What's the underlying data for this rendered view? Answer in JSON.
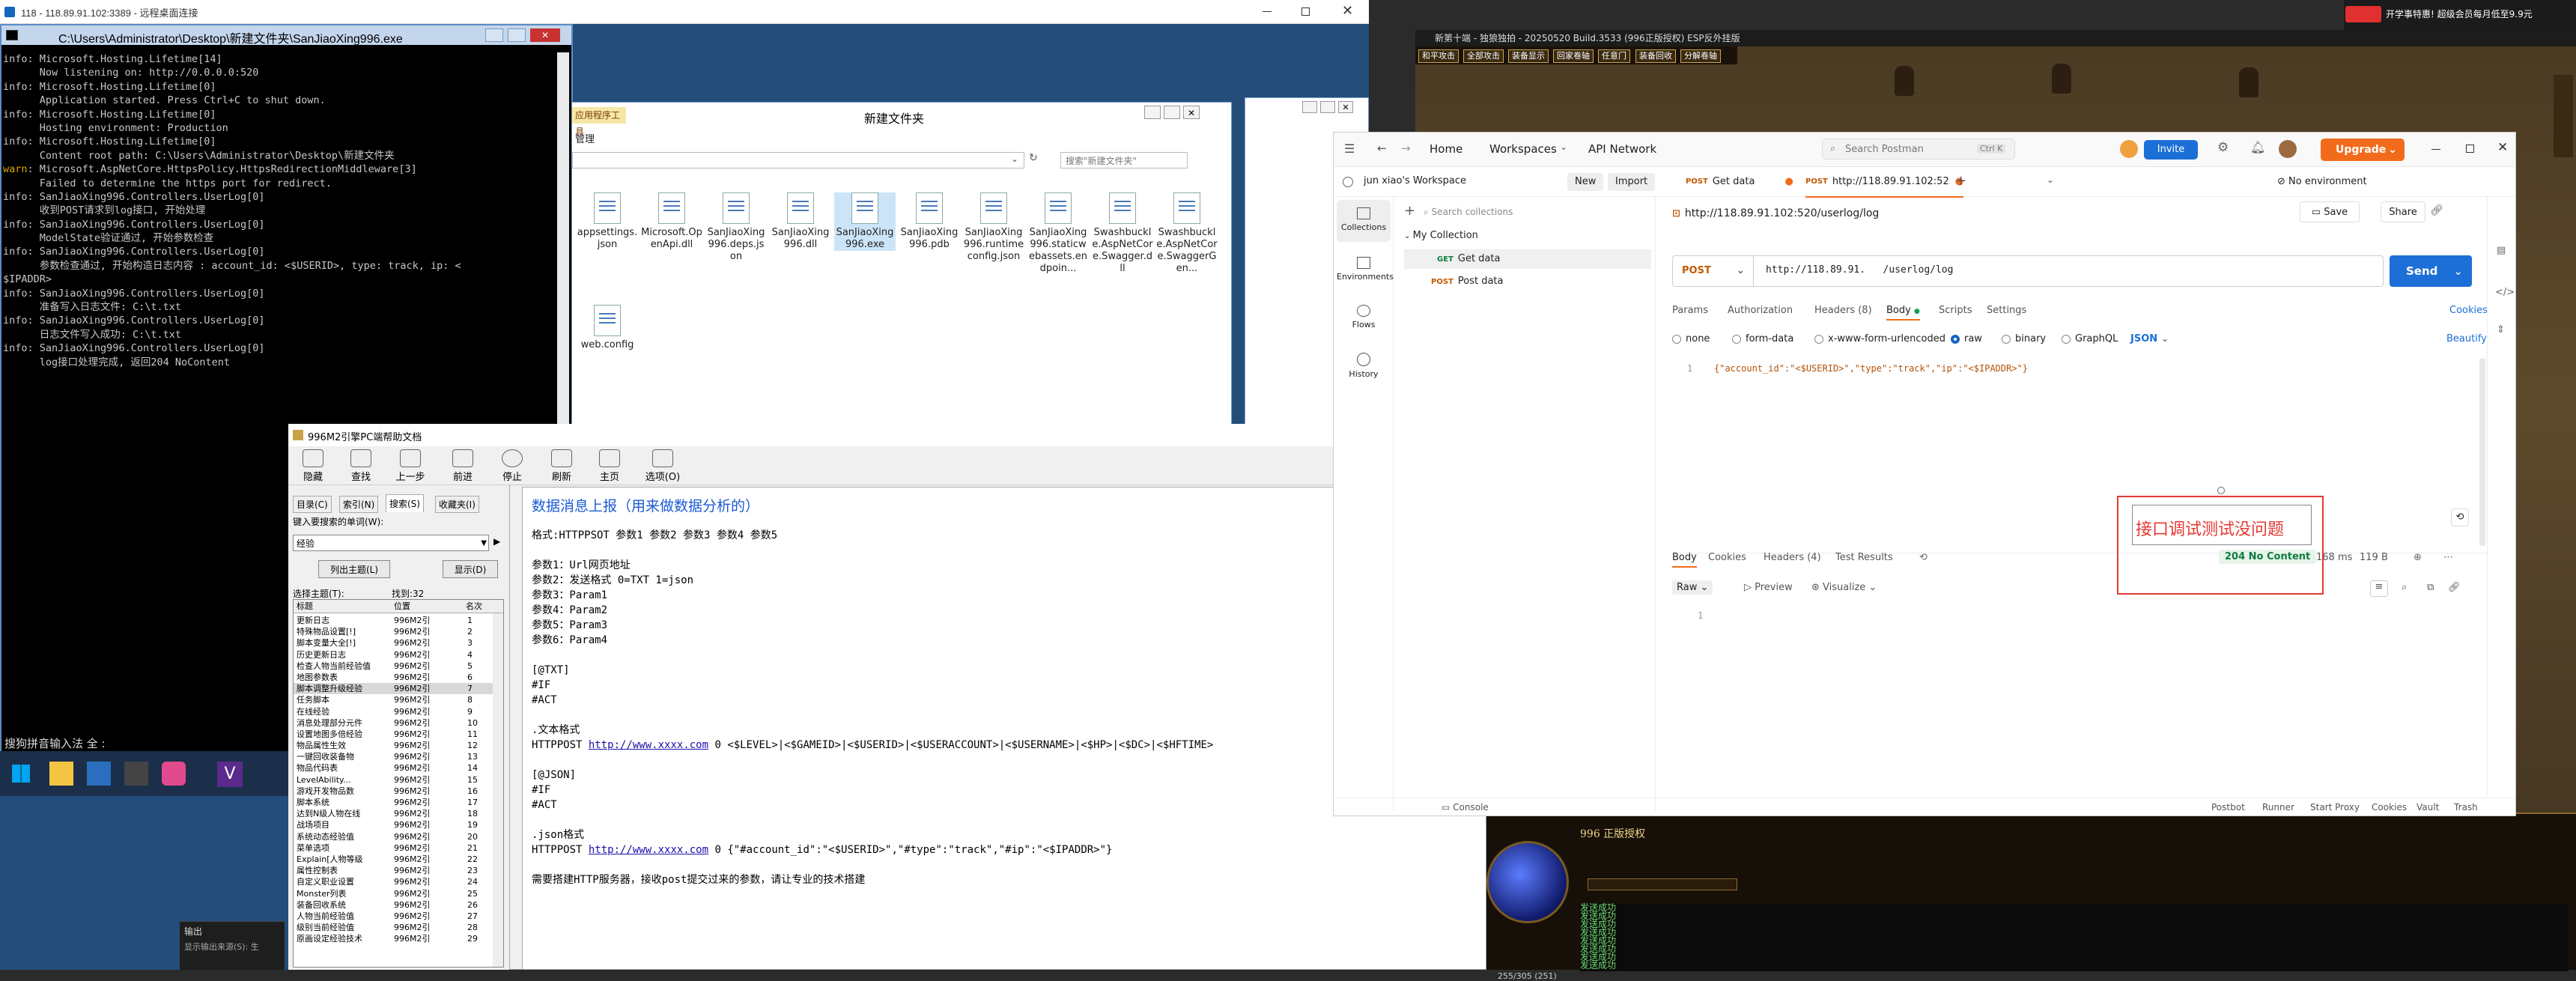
{
  "remote": {
    "title": "118 - 118.89.91.102:3389 - 远程桌面连接"
  },
  "cmd": {
    "title": "C:\\Users\\Administrator\\Desktop\\新建文件夹\\SanJiaoXing996.exe",
    "lines": [
      {
        "lvl": "info",
        "text": "Microsoft.Hosting.Lifetime[14]"
      },
      {
        "lvl": "",
        "text": "      Now listening on: http://0.0.0.0:520"
      },
      {
        "lvl": "info",
        "text": "Microsoft.Hosting.Lifetime[0]"
      },
      {
        "lvl": "",
        "text": "      Application started. Press Ctrl+C to shut down."
      },
      {
        "lvl": "info",
        "text": "Microsoft.Hosting.Lifetime[0]"
      },
      {
        "lvl": "",
        "text": "      Hosting environment: Production"
      },
      {
        "lvl": "info",
        "text": "Microsoft.Hosting.Lifetime[0]"
      },
      {
        "lvl": "",
        "text": "      Content root path: C:\\Users\\Administrator\\Desktop\\新建文件夹"
      },
      {
        "lvl": "warn",
        "text": "Microsoft.AspNetCore.HttpsPolicy.HttpsRedirectionMiddleware[3]"
      },
      {
        "lvl": "",
        "text": "      Failed to determine the https port for redirect."
      },
      {
        "lvl": "info",
        "text": "SanJiaoXing996.Controllers.UserLog[0]"
      },
      {
        "lvl": "",
        "text": "      收到POST请求到log接口, 开始处理"
      },
      {
        "lvl": "info",
        "text": "SanJiaoXing996.Controllers.UserLog[0]"
      },
      {
        "lvl": "",
        "text": "      ModelState验证通过, 开始参数检查"
      },
      {
        "lvl": "info",
        "text": "SanJiaoXing996.Controllers.UserLog[0]"
      },
      {
        "lvl": "",
        "text": "      参数检查通过, 开始构造日志内容 : account_id: <$USERID>, type: track, ip: <"
      },
      {
        "lvl": "",
        "text": "$IPADDR>"
      },
      {
        "lvl": "info",
        "text": "SanJiaoXing996.Controllers.UserLog[0]"
      },
      {
        "lvl": "",
        "text": "      准备写入日志文件: C:\\t.txt"
      },
      {
        "lvl": "info",
        "text": "SanJiaoXing996.Controllers.UserLog[0]"
      },
      {
        "lvl": "",
        "text": "      日志文件写入成功: C:\\t.txt"
      },
      {
        "lvl": "info",
        "text": "SanJiaoXing996.Controllers.UserLog[0]"
      },
      {
        "lvl": "",
        "text": "      log接口处理完成, 返回204 NoContent"
      }
    ],
    "ime": "搜狗拼音输入法 全 :"
  },
  "explorer": {
    "title": "新建文件夹",
    "ribbon_tab": "应用程序工具",
    "ribbon_manage": "管理",
    "search_placeholder": "搜索\"新建文件夹\"",
    "files": [
      "appsettings.json",
      "Microsoft.OpenApi.dll",
      "SanJiaoXing996.deps.json",
      "SanJiaoXing996.dll",
      "SanJiaoXing996.exe",
      "SanJiaoXing996.pdb",
      "SanJiaoXing996.runtimeconfig.json",
      "SanJiaoXing996.staticwebassets.endpoin...",
      "Swashbuckle.AspNetCore.Swagger.dll",
      "Swashbuckle.AspNetCore.SwaggerGen...",
      "web.config"
    ]
  },
  "taskbar": {
    "output_label": "输出",
    "output_text": "显示输出来源(S): 生"
  },
  "help": {
    "title": "996M2引擎PC端帮助文档",
    "toolbar": [
      "隐藏",
      "查找",
      "上一步",
      "前进",
      "停止",
      "刷新",
      "主页",
      "选项(O)"
    ],
    "tabs": [
      "目录(C)",
      "索引(N)",
      "搜索(S)",
      "收藏夹(I)"
    ],
    "search_label": "键入要搜索的单词(W):",
    "search_value": "经验",
    "list_topics": "列出主题(L)",
    "display": "显示(D)",
    "select_topic": "选择主题(T):",
    "found": "找到:32",
    "col_title": "标题",
    "col_pos": "位置",
    "col_rank": "名次",
    "results": [
      "更新日志",
      "特殊物品设置[!]",
      "脚本变量大全[!]",
      "历史更新日志",
      "检查人物当前经验值",
      "地图参数表",
      "脚本调整升级经验",
      "任务脚本",
      "在线经验",
      "消息处理部分元件",
      "设置地图多倍经验",
      "物品属性生效",
      "一键回收装备物",
      "物品代码表",
      "LevelAbility...",
      "游戏开发物品数",
      "脚本系统",
      "达到N级人物在线",
      "战场项目",
      "系统动态经验值",
      "菜单选项",
      "Explain[人物等级",
      "属性控制表",
      "自定义职业设置",
      "Monster列表",
      "装备回收系统",
      "人物当前经验值",
      "级别当前经验值",
      "原画设定经验技术"
    ],
    "result_pos": "996M2引",
    "content_title": "数据消息上报（用来做数据分析的）",
    "content": {
      "format": "格式:HTTPPSOT 参数1 参数2 参数3 参数4 参数5",
      "p1": "参数1：Url网页地址",
      "p2": "参数2：发送格式 0=TXT 1=json",
      "p3": "参数3：Param1",
      "p4": "参数4：Param2",
      "p5": "参数5：Param3",
      "p6": "参数6：Param4",
      "t1": "[@TXT]",
      "t2": "#IF",
      "t3": "#ACT",
      "txt_fmt": ".文本格式",
      "httppost": "HTTPPOST",
      "url": "http://www.xxxx.com",
      "txt_line": " 0 <$LEVEL>|<$GAMEID>|<$USERID>|<$USERACCOUNT>|<$USERNAME>|<$HP>|<$DC>|<$HFTIME>",
      "j1": "[@JSON]",
      "j2": "#IF",
      "j3": "#ACT",
      "json_fmt": ".json格式",
      "json_line": " 0 {\"#account_id\":\"<$USERID>\",\"#type\":\"track\",\"#ip\":\"<$IPADDR>\"}",
      "note": "需要搭建HTTP服务器，接收post提交过来的参数，请让专业的技术搭建"
    }
  },
  "game": {
    "title": "新第十端 - 独狼独拍 - 20250520 Build.3533 (996正版授权) ESP反外挂版",
    "top_right": "开学事特惠! 超级会员每月低至9.9元",
    "buttons": [
      "和平攻击",
      "全部攻击",
      "装备显示",
      "回家卷轴",
      "任意门",
      "装备回收",
      "分解卷轴"
    ],
    "bottom_title": "996 正版授权",
    "chat": [
      "发送成功",
      "发送成功",
      "发送成功",
      "发送成功",
      "发送成功",
      "发送成功",
      "发送成功",
      "发送成功"
    ],
    "coords": "255/305 (251)"
  },
  "postman": {
    "nav": {
      "home": "Home",
      "workspaces": "Workspaces",
      "api_network": "API Network",
      "search": "Search Postman",
      "shortcut": "Ctrl K",
      "invite": "Invite",
      "upgrade": "Upgrade"
    },
    "workspace": "jun xiao's Workspace",
    "new": "New",
    "import": "Import",
    "sidebar": [
      "Collections",
      "Environments",
      "Flows",
      "History"
    ],
    "search_collections": "Search collections",
    "collection": "My Collection",
    "req_get": "Get data",
    "req_post": "Post data",
    "tab_get": "Get data",
    "tab_post": "http://118.89.91.102:52",
    "no_env": "No environment",
    "request_title": "http://118.89.91.102:520/userlog/log",
    "save": "Save",
    "share": "Share",
    "method": "POST",
    "url": "http://118.89.91.   /userlog/log",
    "send": "Send",
    "req_tabs": [
      "Params",
      "Authorization",
      "Headers (8)",
      "Body",
      "Scripts",
      "Settings"
    ],
    "cookies": "Cookies",
    "body_types": [
      "none",
      "form-data",
      "x-www-form-urlencoded",
      "raw",
      "binary",
      "GraphQL"
    ],
    "json": "JSON",
    "beautify": "Beautify",
    "line_no": "1",
    "body_code": "{\"account_id\":\"<$USERID>\",\"type\":\"track\",\"ip\":\"<$IPADDR>\"}",
    "resp_tabs": [
      "Body",
      "Cookies",
      "Headers (4)",
      "Test Results"
    ],
    "status": "204 No Content",
    "time": "168 ms",
    "size": "119 B",
    "raw": "Raw",
    "preview": "Preview",
    "visualize": "Visualize",
    "resp_line": "1",
    "annotation": "接口调试测试没问题",
    "footer": [
      "Console",
      "Postbot",
      "Runner",
      "Start Proxy",
      "Cookies",
      "Vault",
      "Trash"
    ]
  }
}
